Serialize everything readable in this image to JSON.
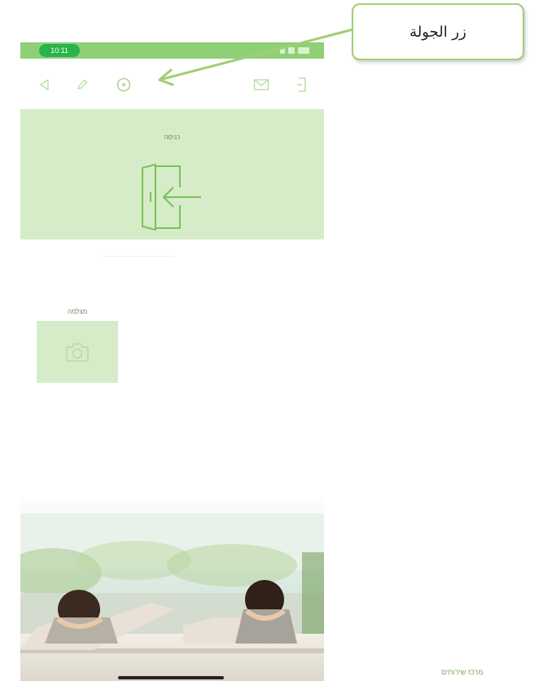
{
  "status_bar": {
    "time": "10:11"
  },
  "toolbar": {
    "icons": [
      "back-icon",
      "edit-icon",
      "tour-icon",
      "mail-icon",
      "exit-icon"
    ]
  },
  "entry_panel": {
    "label": "כניסה",
    "icon": "door-enter-icon"
  },
  "camera_card": {
    "label": "מצלמה",
    "icon": "camera-icon"
  },
  "callout": {
    "text": "زر الجولة"
  },
  "footer": {
    "text": "מרכז שירותים"
  },
  "colors": {
    "accent": "#8dd076",
    "panel": "#d6ecc8",
    "status_pill": "#29b34a",
    "callout_border": "#a2ce72"
  }
}
